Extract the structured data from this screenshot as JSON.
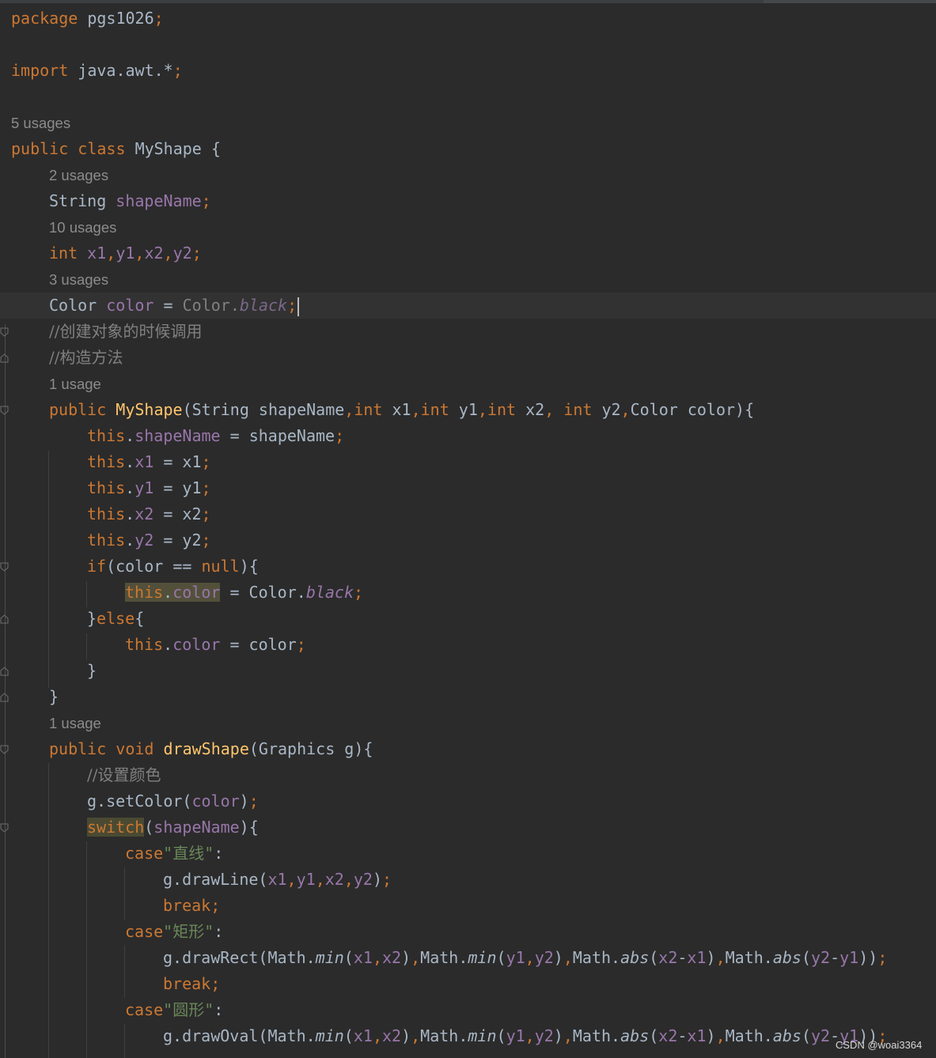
{
  "editor": {
    "language": "java",
    "theme_colors": {
      "background": "#2b2b2b",
      "keyword": "#cc7832",
      "field": "#9876aa",
      "method": "#ffc66d",
      "comment": "#808080",
      "string": "#6a8759",
      "text": "#a9b7c6"
    },
    "code": {
      "package_kw": "package",
      "package_name": " pgs1026",
      "semi": ";",
      "import_kw": "import",
      "import_name": " java.awt.*",
      "hint_class": "5 usages",
      "public": "public",
      "class_kw": "class",
      "class_name": "MyShape",
      "open_brace": " {",
      "hint_shape_name": "2 usages",
      "string_type": "String",
      "shape_name_field": "shapeName",
      "hint_coords": "10 usages",
      "int_kw": "int",
      "x1": "x1",
      "y1": "y1",
      "x2": "x2",
      "y2": "y2",
      "comma": ",",
      "hint_color": "3 usages",
      "color_type": "Color",
      "color_field": "color",
      "assign": " = ",
      "color_class_dim": "Color.",
      "black": "black",
      "comment_create": "//创建对象的时候调用",
      "comment_ctor": "//构造方法",
      "hint_ctor": "1 usage",
      "ctor_name": "MyShape",
      "ctor_params_1": "(String shapeName",
      "ctor_p_x1": " x1",
      "ctor_p_y1": " y1",
      "ctor_p_x2": " x2",
      "ctor_p_y2": " y2",
      "ctor_p_color": "Color color){",
      "comma_space": ", ",
      "this_kw": "this",
      "dot": ".",
      "assign_shape": " = shapeName",
      "assign_x1": " = x1",
      "assign_y1": " = y1",
      "assign_x2": " = x2",
      "assign_y2": " = y2",
      "if_kw": "if",
      "if_cond": "(color == ",
      "null_kw": "null",
      "if_close": "){",
      "assign_color_black": " = Color.",
      "close_else_open": "}",
      "else_kw": "else",
      "brace_open": "{",
      "assign_color_param": " = color",
      "brace_close": "}",
      "hint_draw": "1 usage",
      "void_kw": "void",
      "draw_method": "drawShape",
      "draw_params": "(Graphics g){",
      "comment_set_color": "//设置颜色",
      "set_color_call": "g.setColor(",
      "paren_close": ")",
      "switch_kw": "switch",
      "paren_open": "(",
      "switch_close": "){",
      "case_kw": "case",
      "quote": "\"",
      "case_line": "直线",
      "colon": ":",
      "draw_line_call": "g.drawLine(",
      "break_kw": "break",
      "case_rect": "矩形",
      "draw_rect_call": "g.drawRect(",
      "math_prefix": "Math.",
      "min": "min",
      "abs": "abs",
      "minus": "-",
      "case_oval": "圆形",
      "draw_oval_call": "g.drawOval("
    }
  },
  "watermark": "CSDN @woai3364"
}
